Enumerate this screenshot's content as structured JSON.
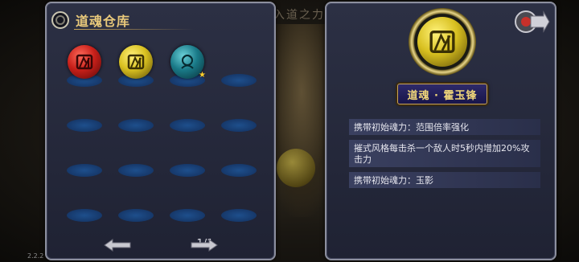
{
  "background": {
    "title": "入道之力"
  },
  "version": "2.2.2",
  "left_panel": {
    "title": "道魂仓库",
    "items": [
      {
        "color": "red",
        "glyph": "soul-emblem-icon",
        "starred": false
      },
      {
        "color": "gold",
        "glyph": "soul-emblem-icon",
        "starred": false
      },
      {
        "color": "teal",
        "glyph": "face-emblem-icon",
        "starred": true
      }
    ],
    "empty_slots": 13,
    "pager": {
      "text": "1/1"
    }
  },
  "right_panel": {
    "name": "道魂 · 霍玉锋",
    "descriptions": [
      "携带初始魂力：范围倍率强化",
      "摧式风格每击杀一个敌人时5秒内增加20%攻击力",
      "携带初始魂力：玉影"
    ]
  },
  "colors": {
    "accent_gold": "#e8c87a",
    "panel_bg": "#2c3044",
    "slot_blue": "#1e4f8c"
  }
}
